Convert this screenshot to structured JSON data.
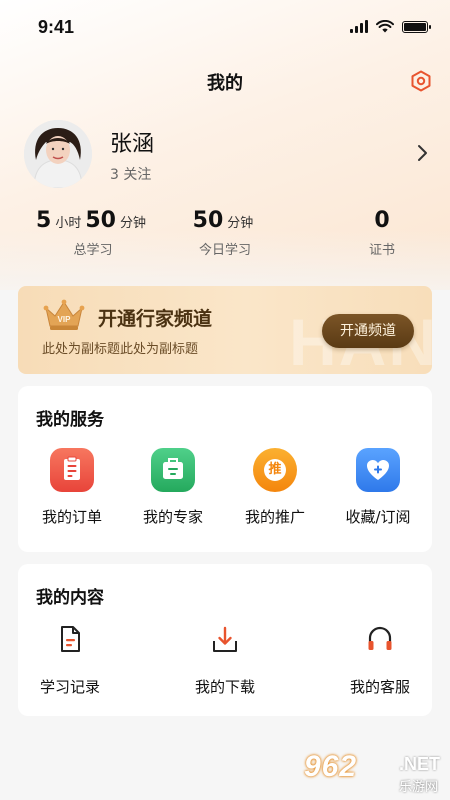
{
  "status_bar": {
    "time": "9:41"
  },
  "nav": {
    "title": "我的"
  },
  "profile": {
    "name": "张涵",
    "follow_text": "3 关注"
  },
  "stats": [
    {
      "value_parts": [
        "5",
        "小时",
        "50",
        "分钟"
      ],
      "label": "总学习"
    },
    {
      "value_parts": [
        "50",
        "分钟"
      ],
      "label": "今日学习"
    },
    {
      "value_parts": [
        "0"
      ],
      "label": "证书"
    }
  ],
  "vip": {
    "title": "开通行家频道",
    "subtitle": "此处为副标题此处为副标题",
    "button": "开通频道",
    "badge": "VIP",
    "watermark": "HAN"
  },
  "services": {
    "title": "我的服务",
    "items": [
      {
        "label": "我的订单",
        "icon": "clipboard-icon",
        "color": "#ef5b4a"
      },
      {
        "label": "我的专家",
        "icon": "briefcase-icon",
        "color": "#2fb66a"
      },
      {
        "label": "我的推广",
        "icon": "promote-icon",
        "color": "#f79a14",
        "glyph": "推"
      },
      {
        "label": "收藏/订阅",
        "icon": "heart-plus-icon",
        "color": "#3d8af2"
      }
    ]
  },
  "contents": {
    "title": "我的内容",
    "items": [
      {
        "label": "学习记录",
        "icon": "document-icon"
      },
      {
        "label": "我的下载",
        "icon": "download-icon"
      },
      {
        "label": "我的客服",
        "icon": "headset-icon"
      }
    ]
  },
  "watermark": {
    "brand": "962",
    "suffix": ".NET",
    "site": "乐游网"
  },
  "colors": {
    "accent": "#e8542e",
    "vip_button": "#6b4619",
    "background": "#f6f6f6"
  }
}
